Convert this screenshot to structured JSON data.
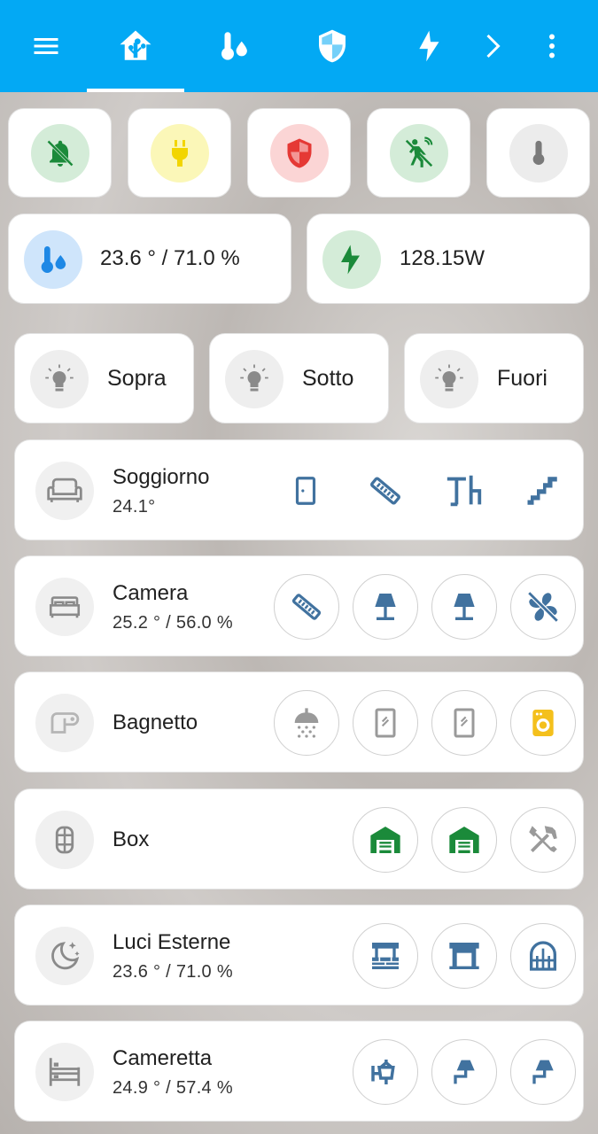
{
  "colors": {
    "topbar": "#03a9f4",
    "icon_blue": "#41729f",
    "green": "#1b8a3a",
    "red": "#e53935",
    "yellow": "#f4d03f"
  },
  "topbar": {
    "tabs": [
      "menu-icon",
      "home-icon",
      "thermometer-water-icon",
      "shield-icon",
      "lightning-icon",
      "chevron-right-icon",
      "more-vertical-icon"
    ]
  },
  "status_chips": [
    "bell-off-icon",
    "plug-icon",
    "shield-icon",
    "motion-sensor-icon",
    "thermometer-icon"
  ],
  "climate": {
    "value": "23.6 ° / 71.0 %"
  },
  "power": {
    "value": "128.15W"
  },
  "light_groups": [
    {
      "label": "Sopra"
    },
    {
      "label": "Sotto"
    },
    {
      "label": "Fuori"
    }
  ],
  "rooms": [
    {
      "name": "Soggiorno",
      "sub": "24.1°"
    },
    {
      "name": "Camera",
      "sub": "25.2 ° / 56.0 %"
    },
    {
      "name": "Bagnetto",
      "sub": ""
    },
    {
      "name": "Box",
      "sub": ""
    },
    {
      "name": "Luci Esterne",
      "sub": "23.6 ° / 71.0 %"
    },
    {
      "name": "Cameretta",
      "sub": "24.9 ° / 57.4 %"
    }
  ]
}
